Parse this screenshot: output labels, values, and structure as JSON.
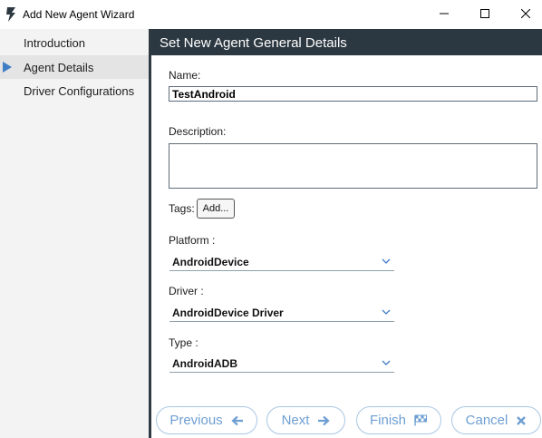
{
  "window": {
    "title": "Add New Agent Wizard",
    "icon": "lightning-bolt-icon"
  },
  "sidebar": {
    "items": [
      {
        "label": "Introduction",
        "active": false
      },
      {
        "label": "Agent Details",
        "active": true
      },
      {
        "label": "Driver Configurations",
        "active": false
      }
    ]
  },
  "main": {
    "header_title": "Set New Agent General Details",
    "name_label": "Name:",
    "name_value": "TestAndroid",
    "description_label": "Description:",
    "description_value": "",
    "tags_label": "Tags:",
    "tags_add_label": "Add...",
    "platform_label": "Platform :",
    "platform_value": "AndroidDevice",
    "driver_label": "Driver :",
    "driver_value": "AndroidDevice Driver",
    "type_label": "Type :",
    "type_value": "AndroidADB"
  },
  "footer": {
    "previous_label": "Previous",
    "next_label": "Next",
    "finish_label": "Finish",
    "cancel_label": "Cancel"
  },
  "colors": {
    "header_bg": "#2c3841",
    "accent": "#3f7dc5",
    "button_text": "#6e9fd3",
    "sidebar_bg": "#f3f3f3"
  }
}
